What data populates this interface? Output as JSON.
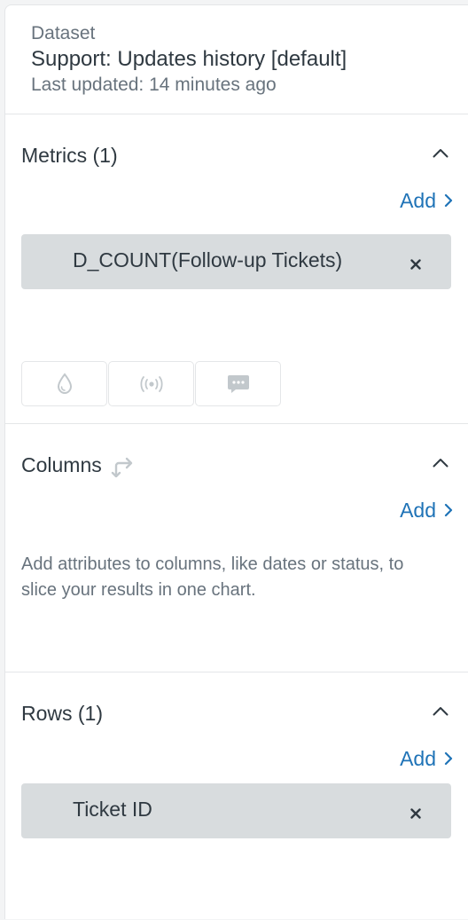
{
  "dataset": {
    "label": "Dataset",
    "name": "Support: Updates history [default]",
    "last_updated": "Last updated: 14 minutes ago"
  },
  "metrics": {
    "title": "Metrics (1)",
    "add_label": "Add",
    "items": [
      {
        "label": "D_COUNT(Follow-up Tickets)"
      }
    ],
    "tool_icons": [
      "drop-icon",
      "broadcast-icon",
      "comment-icon"
    ]
  },
  "columns": {
    "title": "Columns",
    "add_label": "Add",
    "help_text": "Add attributes to columns, like dates or status, to slice your results in one chart."
  },
  "rows": {
    "title": "Rows (1)",
    "add_label": "Add",
    "items": [
      {
        "label": "Ticket ID"
      }
    ]
  },
  "colors": {
    "accent": "#1f73b7",
    "pill_bg": "#d8dcde",
    "muted_text": "#68737d",
    "text": "#2f3941",
    "divider": "#e4e6e8"
  }
}
